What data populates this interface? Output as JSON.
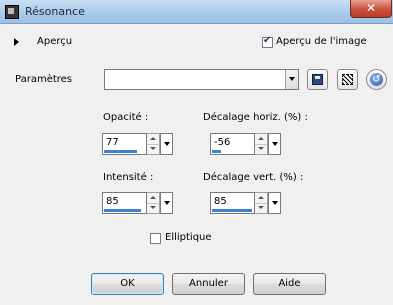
{
  "window": {
    "title": "Résonance",
    "close_glyph": "✕"
  },
  "preview": {
    "toggle_label": "Aperçu",
    "image_preview_label": "Aperçu de l'image",
    "image_preview_checked": true
  },
  "presets": {
    "label": "Paramètres",
    "value": ""
  },
  "fields": {
    "opacity": {
      "label": "Opacité :",
      "value": "77",
      "level_pct": 77
    },
    "h_offset": {
      "label": "Décalage horiz. (%) :",
      "value": "-56",
      "level_pct": 22
    },
    "intensity": {
      "label": "Intensité :",
      "value": "85",
      "level_pct": 85
    },
    "v_offset": {
      "label": "Décalage vert. (%) :",
      "value": "85",
      "level_pct": 92
    }
  },
  "elliptique": {
    "label": "Elliptique",
    "checked": false
  },
  "buttons": {
    "ok": "OK",
    "cancel": "Annuler",
    "help": "Aide"
  },
  "icons": {
    "window": "app-icon",
    "save": "save-preset-icon",
    "randomize": "randomize-icon",
    "reset": "reset-icon"
  },
  "colors": {
    "accent": "#3f7fd6",
    "title_bar": "#a9c9ea",
    "close": "#c9503d",
    "background": "#f0f0f0"
  }
}
